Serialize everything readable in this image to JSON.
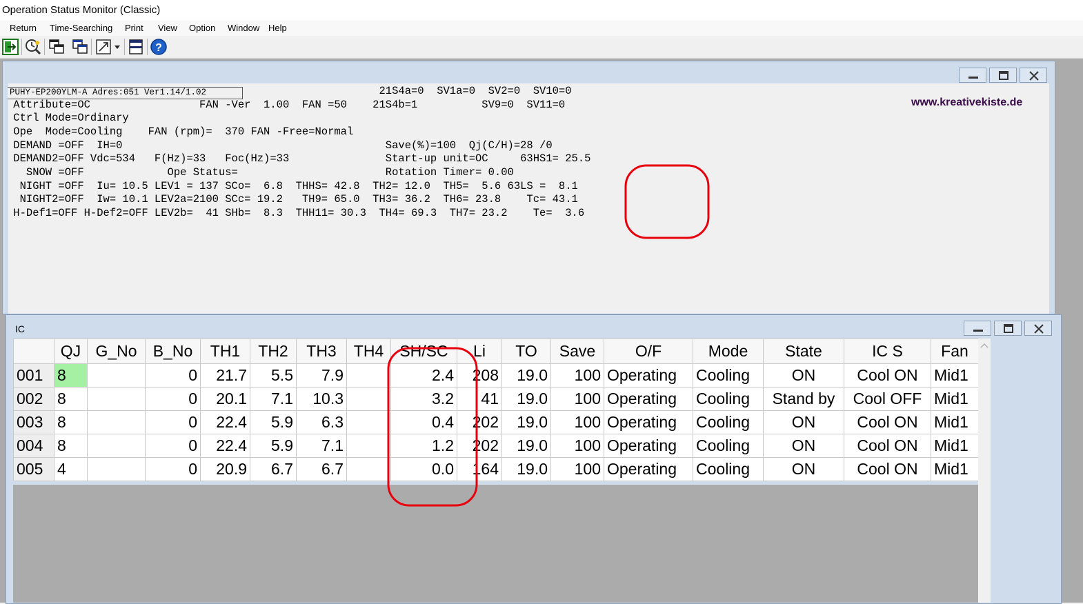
{
  "app": {
    "title": "Operation Status Monitor (Classic)"
  },
  "menu": [
    "Return",
    "Time-Searching",
    "Print",
    "View",
    "Option",
    "Window",
    "Help"
  ],
  "toolbar": {
    "icons": [
      "exit-icon",
      "time-search-icon",
      "copy-window-icon",
      "cascade-windows-icon",
      "zoom-icon",
      "dropdown-arrow-icon",
      "split-view-icon",
      "help-icon"
    ]
  },
  "outdoor": {
    "header": "PUHY-EP200YLM-A Adres:051 Ver1.14/1.02",
    "brand": "www.kreativekiste.de",
    "lines": [
      "                                                          21S4a=0  SV1a=0  SV2=0  SV10=0",
      " Attribute=OC                 FAN -Ver  1.00  FAN =50    21S4b=1          SV9=0  SV11=0",
      " Ctrl Mode=Ordinary",
      " Ope  Mode=Cooling    FAN (rpm)=  370 FAN -Free=Normal",
      " DEMAND =OFF  IH=0                                         Save(%)=100  Qj(C/H)=28 /0",
      " DEMAND2=OFF Vdc=534   F(Hz)=33   Foc(Hz)=33               Start-up unit=OC     63HS1= 25.5",
      "   SNOW =OFF             Ope Status=                       Rotation Timer= 0.00",
      "  NIGHT =OFF  Iu= 10.5 LEV1 = 137 SCo=  6.8  THHS= 42.8  TH2= 12.0  TH5=  5.6 63LS =  8.1",
      "  NIGHT2=OFF  Iw= 10.1 LEV2a=2100 SCc= 19.2   TH9= 65.0  TH3= 36.2  TH6= 23.8    Tc= 43.1",
      " H-Def1=OFF H-Def2=OFF LEV2b=  41 SHb=  8.3  THH11= 30.3  TH4= 69.3  TH7= 23.2    Te=  3.6"
    ]
  },
  "ic": {
    "title": "IC",
    "columns": [
      "",
      "QJ",
      "G_No",
      "B_No",
      "TH1",
      "TH2",
      "TH3",
      "TH4",
      "SH/SC",
      "Li",
      "TO",
      "Save",
      "O/F",
      "Mode",
      "State",
      "IC S",
      "Fan"
    ],
    "rows": [
      [
        "001",
        "8",
        "",
        "0",
        "21.7",
        "5.5",
        "7.9",
        "",
        "2.4",
        "208",
        "19.0",
        "100",
        "Operating",
        "Cooling",
        "ON",
        "Cool ON",
        "Mid1"
      ],
      [
        "002",
        "8",
        "",
        "0",
        "20.1",
        "7.1",
        "10.3",
        "",
        "3.2",
        "41",
        "19.0",
        "100",
        "Operating",
        "Cooling",
        "Stand by",
        "Cool OFF",
        "Mid1"
      ],
      [
        "003",
        "8",
        "",
        "0",
        "22.4",
        "5.9",
        "6.3",
        "",
        "0.4",
        "202",
        "19.0",
        "100",
        "Operating",
        "Cooling",
        "ON",
        "Cool ON",
        "Mid1"
      ],
      [
        "004",
        "8",
        "",
        "0",
        "22.4",
        "5.9",
        "7.1",
        "",
        "1.2",
        "202",
        "19.0",
        "100",
        "Operating",
        "Cooling",
        "ON",
        "Cool ON",
        "Mid1"
      ],
      [
        "005",
        "4",
        "",
        "0",
        "20.9",
        "6.7",
        "6.7",
        "",
        "0.0",
        "164",
        "19.0",
        "100",
        "Operating",
        "Cooling",
        "ON",
        "Cool ON",
        "Mid1"
      ]
    ]
  },
  "colors": {
    "highlight_cell": "#a4f1a4",
    "annotation": "#e8000d",
    "brand": "#3a0c4a"
  }
}
